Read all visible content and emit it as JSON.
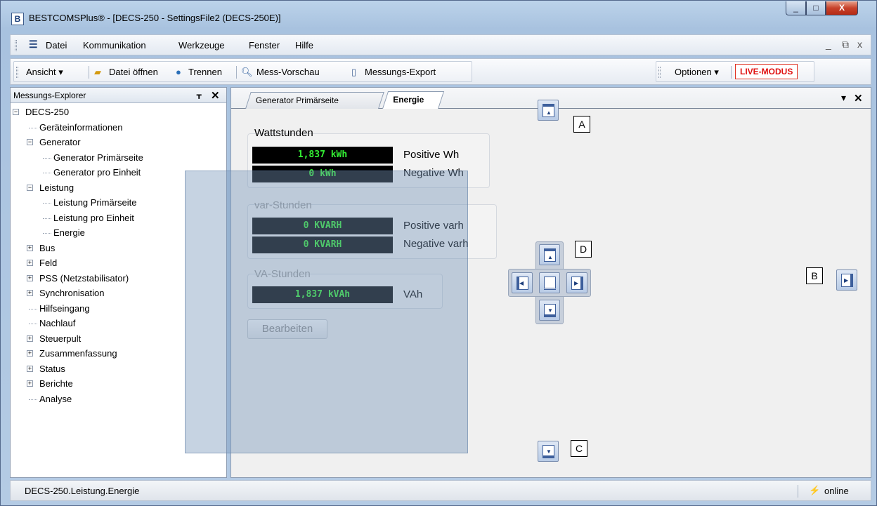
{
  "window": {
    "title": "BESTCOMSPlus® - [DECS-250 - SettingsFile2 (DECS-250E)]",
    "app_icon_letter": "B",
    "min_glyph": "_",
    "max_glyph": "□",
    "close_glyph": "X"
  },
  "menubar": {
    "items": [
      "Datei",
      "Kommunikation",
      "Werkzeuge",
      "Fenster",
      "Hilfe"
    ],
    "mdi_min": "_",
    "mdi_restore": "⧉",
    "mdi_close": "x"
  },
  "toolbar": {
    "view": "Ansicht ▾",
    "open_file": "Datei öffnen",
    "disconnect": "Trennen",
    "preview": "Mess-Vorschau",
    "export": "Messungs-Export",
    "options": "Optionen ▾",
    "live_mode": "LIVE-MODUS"
  },
  "explorer": {
    "title": "Messungs-Explorer",
    "pin": "ᚁ",
    "close": "✕",
    "tree": [
      {
        "label": "DECS-250",
        "level": 0,
        "toggle": "−"
      },
      {
        "label": "Geräteinformationen",
        "level": 1,
        "toggle": ""
      },
      {
        "label": "Generator",
        "level": 1,
        "toggle": "−"
      },
      {
        "label": "Generator Primärseite",
        "level": 2,
        "toggle": ""
      },
      {
        "label": "Generator pro Einheit",
        "level": 2,
        "toggle": ""
      },
      {
        "label": "Leistung",
        "level": 1,
        "toggle": "−"
      },
      {
        "label": "Leistung Primärseite",
        "level": 2,
        "toggle": ""
      },
      {
        "label": "Leistung pro Einheit",
        "level": 2,
        "toggle": ""
      },
      {
        "label": "Energie",
        "level": 2,
        "toggle": ""
      },
      {
        "label": "Bus",
        "level": 1,
        "toggle": "+"
      },
      {
        "label": "Feld",
        "level": 1,
        "toggle": "+"
      },
      {
        "label": "PSS (Netzstabilisator)",
        "level": 1,
        "toggle": "+"
      },
      {
        "label": "Synchronisation",
        "level": 1,
        "toggle": "+"
      },
      {
        "label": "Hilfseingang",
        "level": 1,
        "toggle": ""
      },
      {
        "label": "Nachlauf",
        "level": 1,
        "toggle": ""
      },
      {
        "label": "Steuerpult",
        "level": 1,
        "toggle": "+"
      },
      {
        "label": "Zusammenfassung",
        "level": 1,
        "toggle": "+"
      },
      {
        "label": "Status",
        "level": 1,
        "toggle": "+"
      },
      {
        "label": "Berichte",
        "level": 1,
        "toggle": "+"
      },
      {
        "label": "Analyse",
        "level": 1,
        "toggle": ""
      }
    ]
  },
  "tabs": {
    "items": [
      "Generator Primärseite",
      "Energie"
    ],
    "active_index": 1,
    "menu_glyph": "▾",
    "close_glyph": "✕"
  },
  "energy": {
    "watt_title": "Wattstunden",
    "watt_pos_value": "1,837 kWh",
    "watt_pos_label": "Positive Wh",
    "watt_neg_value": "0 kWh",
    "watt_neg_label": "Negative Wh",
    "var_title": "var-Stunden",
    "var_pos_value": "0 KVARH",
    "var_pos_label": "Positive varh",
    "var_neg_value": "0 KVARH",
    "var_neg_label": "Negative varh",
    "va_title": "VA-Stunden",
    "va_value": "1,837 kVAh",
    "va_label": "VAh",
    "edit_button": "Bearbeiten"
  },
  "dock_guides": {
    "label_a": "A",
    "label_b": "B",
    "label_c": "C",
    "label_d": "D"
  },
  "statusbar": {
    "path": "DECS-250.Leistung.Energie",
    "connection": "online"
  }
}
